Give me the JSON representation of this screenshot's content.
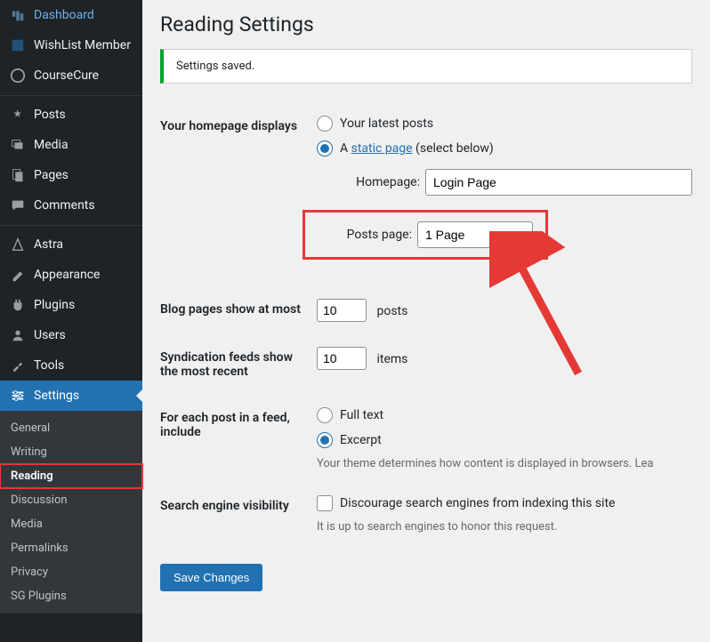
{
  "sidebar": {
    "items": [
      {
        "label": "Dashboard",
        "icon": "dashboard"
      },
      {
        "label": "WishList Member",
        "icon": "wishlist"
      },
      {
        "label": "CourseCure",
        "icon": "coursecure"
      }
    ],
    "contentItems": [
      {
        "label": "Posts",
        "icon": "pin"
      },
      {
        "label": "Media",
        "icon": "media"
      },
      {
        "label": "Pages",
        "icon": "pages"
      },
      {
        "label": "Comments",
        "icon": "comments"
      }
    ],
    "siteItems": [
      {
        "label": "Astra",
        "icon": "astra"
      },
      {
        "label": "Appearance",
        "icon": "appearance"
      },
      {
        "label": "Plugins",
        "icon": "plugins"
      },
      {
        "label": "Users",
        "icon": "users"
      },
      {
        "label": "Tools",
        "icon": "tools"
      },
      {
        "label": "Settings",
        "icon": "settings",
        "active": true
      }
    ],
    "submenu": [
      "General",
      "Writing",
      "Reading",
      "Discussion",
      "Media",
      "Permalinks",
      "Privacy",
      "SG Plugins"
    ],
    "submenuActive": "Reading"
  },
  "main": {
    "title": "Reading Settings",
    "notice": "Settings saved.",
    "homepage": {
      "label": "Your homepage displays",
      "options": {
        "latest": "Your latest posts",
        "static_prefix": "A ",
        "static_link": "static page",
        "static_suffix": " (select below)"
      },
      "selects": {
        "homepage_label": "Homepage:",
        "homepage_value": "Login Page",
        "posts_label": "Posts page:",
        "posts_value": "1 Page"
      }
    },
    "blogPages": {
      "label": "Blog pages show at most",
      "value": "10",
      "unit": "posts"
    },
    "syndication": {
      "label": "Syndication feeds show the most recent",
      "value": "10",
      "unit": "items"
    },
    "feedContent": {
      "label": "For each post in a feed, include",
      "full": "Full text",
      "excerpt": "Excerpt",
      "hint": "Your theme determines how content is displayed in browsers. Lea"
    },
    "search": {
      "label": "Search engine visibility",
      "checkbox": "Discourage search engines from indexing this site",
      "hint": "It is up to search engines to honor this request."
    },
    "saveButton": "Save Changes"
  },
  "colors": {
    "highlight": "#e53935",
    "accent": "#2271b1"
  }
}
